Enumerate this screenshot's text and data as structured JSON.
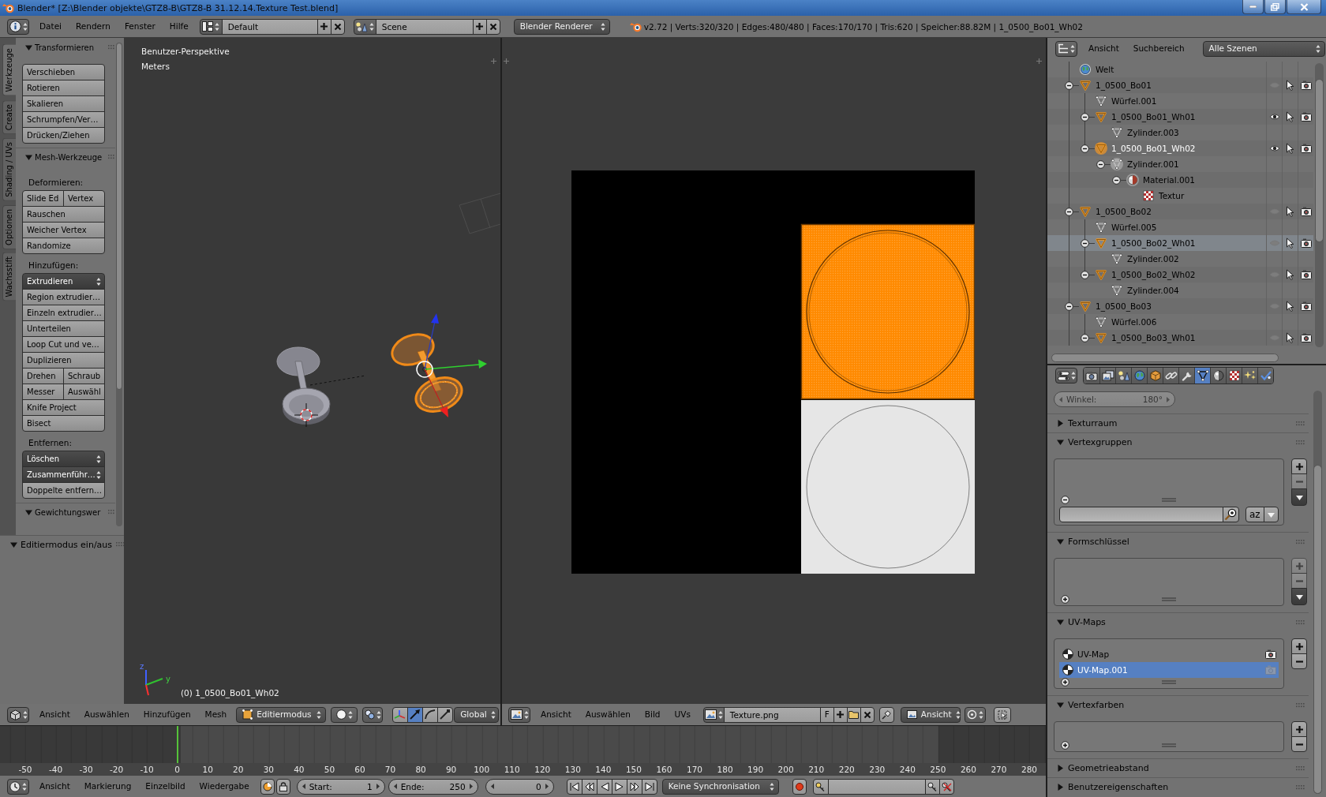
{
  "window": {
    "title": "Blender* [Z:\\Blender objekte\\GTZ8-B\\GTZ8-B 31.12.14.Texture Test.blend]"
  },
  "info_header": {
    "menus": [
      "Datei",
      "Rendern",
      "Fenster",
      "Hilfe"
    ],
    "screen_layout": "Default",
    "scene": "Scene",
    "render_engine": "Blender Renderer",
    "stats": "v2.72 | Verts:320/320 | Edges:480/480 | Faces:170/170 | Tris:620 | Speicher:88.82M | 1_0500_Bo01_Wh02"
  },
  "tool_shelf": {
    "tabs": [
      {
        "label": "Werkzeuge",
        "selected": true
      },
      {
        "label": "Create",
        "selected": false
      },
      {
        "label": "Shading / UVs",
        "selected": false
      },
      {
        "label": "Optionen",
        "selected": false
      },
      {
        "label": "Wachsstift",
        "selected": false
      }
    ],
    "panels": [
      {
        "title": "Transformieren",
        "expanded": true,
        "sections": [
          {
            "rows": [
              [
                {
                  "label": "Verschieben",
                  "kind": "button"
                }
              ],
              [
                {
                  "label": "Rotieren",
                  "kind": "button"
                }
              ],
              [
                {
                  "label": "Skalieren",
                  "kind": "button"
                }
              ],
              [
                {
                  "label": "Schrumpfen/Ver…",
                  "kind": "button"
                }
              ],
              [
                {
                  "label": "Drücken/Ziehen",
                  "kind": "button"
                }
              ]
            ]
          }
        ]
      },
      {
        "title": "Mesh-Werkzeuge",
        "expanded": true,
        "sections": [
          {
            "heading": "Deformieren:",
            "rows": [
              [
                {
                  "label": "Slide Ed",
                  "kind": "button"
                },
                {
                  "label": "Vertex",
                  "kind": "button"
                }
              ],
              [
                {
                  "label": "Rauschen",
                  "kind": "button"
                }
              ],
              [
                {
                  "label": "Weicher Vertex",
                  "kind": "button"
                }
              ],
              [
                {
                  "label": "Randomize",
                  "kind": "button"
                }
              ]
            ]
          },
          {
            "heading": "Hinzufügen:",
            "rows": [
              [
                {
                  "label": "Extrudieren",
                  "kind": "menu"
                }
              ],
              [
                {
                  "label": "Region extrudier…",
                  "kind": "button"
                }
              ],
              [
                {
                  "label": "Einzeln extrudier…",
                  "kind": "button"
                }
              ],
              [
                {
                  "label": "Unterteilen",
                  "kind": "button"
                }
              ],
              [
                {
                  "label": "Loop Cut und ve…",
                  "kind": "button"
                }
              ],
              [
                {
                  "label": "Duplizieren",
                  "kind": "button"
                }
              ],
              [
                {
                  "label": "Drehen",
                  "kind": "button"
                },
                {
                  "label": "Schraub",
                  "kind": "button"
                }
              ],
              [
                {
                  "label": "Messer",
                  "kind": "button"
                },
                {
                  "label": "Auswähl",
                  "kind": "button"
                }
              ],
              [
                {
                  "label": "Knife Project",
                  "kind": "button"
                }
              ],
              [
                {
                  "label": "Bisect",
                  "kind": "button"
                }
              ]
            ]
          },
          {
            "heading": "Entfernen:",
            "rows": [
              [
                {
                  "label": "Löschen",
                  "kind": "menu"
                }
              ],
              [
                {
                  "label": "Zusammenführ…",
                  "kind": "menu"
                }
              ],
              [
                {
                  "label": "Doppelte entfern…",
                  "kind": "button"
                }
              ]
            ]
          }
        ]
      },
      {
        "title": "Gewichtungswer",
        "expanded": true
      }
    ],
    "operator_panel": {
      "title": "Editiermodus ein/aus",
      "expanded": true
    }
  },
  "view3d": {
    "overlay": [
      "Benutzer-Perspektive",
      "Meters"
    ],
    "object_info": "(0) 1_0500_Bo01_Wh02",
    "axis_labels": [
      "z",
      "y"
    ],
    "header": {
      "menus": [
        "Ansicht",
        "Auswählen",
        "Hinzufügen",
        "Mesh"
      ],
      "mode": "Editiermodus",
      "manipulators": [
        {
          "kind": "axes",
          "selected": false
        },
        {
          "kind": "translate",
          "selected": true
        },
        {
          "kind": "rotate",
          "selected": false
        },
        {
          "kind": "scale",
          "selected": false
        }
      ],
      "orientation": "Global"
    }
  },
  "image_editor": {
    "header": {
      "menus": [
        "Ansicht",
        "Auswählen",
        "Bild",
        "UVs"
      ],
      "image": "Texture.png",
      "fake_user": "F",
      "mode": "Ansicht"
    }
  },
  "timeline": {
    "ticks": [
      "-50",
      "-40",
      "-30",
      "-20",
      "-10",
      "0",
      "10",
      "20",
      "30",
      "40",
      "50",
      "60",
      "70",
      "80",
      "90",
      "100",
      "110",
      "120",
      "130",
      "140",
      "150",
      "160",
      "170",
      "180",
      "190",
      "200",
      "210",
      "220",
      "230",
      "240",
      "250",
      "260",
      "270",
      "280"
    ],
    "header": {
      "menus": [
        "Ansicht",
        "Markierung",
        "Einzelbild",
        "Wiedergabe"
      ],
      "start": {
        "label": "Start:",
        "value": "1"
      },
      "end": {
        "label": "Ende:",
        "value": "250"
      },
      "current": "0",
      "sync": "Keine Synchronisation"
    }
  },
  "outliner": {
    "header": {
      "menus": [
        "Ansicht",
        "Suchbereich"
      ],
      "display_mode": "Alle Szenen"
    },
    "items": [
      {
        "name": "Welt",
        "kind": "world",
        "expanded": false,
        "selected": false,
        "active": false
      },
      {
        "name": "1_0500_Bo01",
        "kind": "object",
        "expanded": true,
        "visible": false,
        "selected": false,
        "active": false,
        "children": [
          {
            "name": "Würfel.001",
            "kind": "mesh",
            "expanded": false,
            "selected": false,
            "active": false
          },
          {
            "name": "1_0500_Bo01_Wh01",
            "kind": "object",
            "expanded": true,
            "visible": true,
            "selected": false,
            "active": false,
            "children": [
              {
                "name": "Zylinder.003",
                "kind": "mesh",
                "expanded": false,
                "selected": false,
                "active": false
              }
            ]
          },
          {
            "name": "1_0500_Bo01_Wh02",
            "kind": "object",
            "expanded": true,
            "visible": true,
            "selected": false,
            "active": true,
            "children": [
              {
                "name": "Zylinder.001",
                "kind": "mesh",
                "expanded": true,
                "selected": false,
                "active": true,
                "children": [
                  {
                    "name": "Material.001",
                    "kind": "material",
                    "expanded": true,
                    "selected": false,
                    "active": true,
                    "children": [
                      {
                        "name": "Textur",
                        "kind": "texture",
                        "expanded": false,
                        "selected": false,
                        "active": false
                      }
                    ]
                  }
                ]
              }
            ]
          }
        ]
      },
      {
        "name": "1_0500_Bo02",
        "kind": "object",
        "expanded": true,
        "visible": false,
        "selected": false,
        "active": false,
        "children": [
          {
            "name": "Würfel.005",
            "kind": "mesh",
            "expanded": false,
            "selected": false,
            "active": false
          },
          {
            "name": "1_0500_Bo02_Wh01",
            "kind": "object",
            "expanded": true,
            "visible": false,
            "selected": true,
            "active": false,
            "children": [
              {
                "name": "Zylinder.002",
                "kind": "mesh",
                "expanded": false,
                "selected": false,
                "active": false
              }
            ]
          },
          {
            "name": "1_0500_Bo02_Wh02",
            "kind": "object",
            "expanded": true,
            "visible": false,
            "selected": false,
            "active": false,
            "children": [
              {
                "name": "Zylinder.004",
                "kind": "mesh",
                "expanded": false,
                "selected": false,
                "active": false
              }
            ]
          }
        ]
      },
      {
        "name": "1_0500_Bo03",
        "kind": "object",
        "expanded": true,
        "visible": false,
        "selected": false,
        "active": false,
        "children": [
          {
            "name": "Würfel.006",
            "kind": "mesh",
            "expanded": false,
            "selected": false,
            "active": false
          },
          {
            "name": "1_0500_Bo03_Wh01",
            "kind": "object",
            "expanded": true,
            "visible": false,
            "selected": false,
            "active": false
          }
        ]
      }
    ]
  },
  "properties": {
    "tabs": [
      {
        "kind": "render",
        "selected": false
      },
      {
        "kind": "render_layers",
        "selected": false
      },
      {
        "kind": "scene",
        "selected": false
      },
      {
        "kind": "world",
        "selected": false
      },
      {
        "kind": "object",
        "selected": false
      },
      {
        "kind": "constraints",
        "selected": false
      },
      {
        "kind": "modifiers",
        "selected": false
      },
      {
        "kind": "data",
        "selected": true
      },
      {
        "kind": "material",
        "selected": false
      },
      {
        "kind": "texture",
        "selected": false
      },
      {
        "kind": "particles",
        "selected": false
      },
      {
        "kind": "physics",
        "selected": false
      }
    ],
    "auto_smooth": {
      "label": "Winkel:",
      "value": "180°",
      "disabled": true
    },
    "panels": [
      {
        "title": "Texturraum",
        "kind": "settings",
        "expanded": false
      },
      {
        "title": "Vertexgruppen",
        "kind": "list",
        "expanded": true,
        "filter_open": true,
        "sort_label": "az",
        "add_enabled": true,
        "remove_enabled": false,
        "specials": true
      },
      {
        "title": "Formschlüssel",
        "kind": "list",
        "expanded": true,
        "filter_open": false,
        "add_enabled": false,
        "remove_enabled": false,
        "specials": true
      },
      {
        "title": "UV-Maps",
        "kind": "list",
        "expanded": true,
        "filter_open": false,
        "add_enabled": true,
        "remove_enabled": true,
        "specials": false,
        "items": [
          {
            "name": "UV-Map",
            "selected": false,
            "render_active": true
          },
          {
            "name": "UV-Map.001",
            "selected": true,
            "render_active": false
          }
        ]
      },
      {
        "title": "Vertexfarben",
        "kind": "list",
        "expanded": true,
        "filter_open": false,
        "add_enabled": true,
        "remove_enabled": true,
        "specials": false
      },
      {
        "title": "Geometrieabstand",
        "kind": "settings",
        "expanded": false
      },
      {
        "title": "Benutzereigenschaften",
        "kind": "settings",
        "expanded": false
      }
    ]
  }
}
